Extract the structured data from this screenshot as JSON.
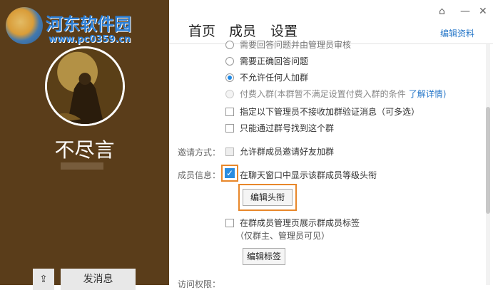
{
  "watermark": {
    "title": "河东软件园",
    "url": "www.pc0359.cn"
  },
  "profile": {
    "name": "不尽言",
    "send_message_label": "发消息"
  },
  "tabs": [
    "首页",
    "成员",
    "设置"
  ],
  "edit_profile": "编辑资料",
  "join_options": {
    "truncated_top": "需要回答问题并由管理员审核",
    "need_answer": "需要正确回答问题",
    "no_one_join": "不允许任何人加群",
    "paid_join": "付费入群(本群暂不满足设置付费入群的条件",
    "learn_more": "了解详情)",
    "admin_no_verify": "指定以下管理员不接收加群验证消息（可多选）",
    "search_only": "只能通过群号找到这个群"
  },
  "invite": {
    "label": "邀请方式：",
    "option": "允许群成员邀请好友加群"
  },
  "member_info": {
    "label": "成员信息：",
    "show_title": "在聊天窗口中显示该群成员等级头衔",
    "edit_title_button": "编辑头衔",
    "show_tags": "在群成员管理页展示群成员标签",
    "tags_note": "（仅群主、管理员可见）",
    "edit_tags_button": "编辑标签"
  },
  "bottom_label": "访问权限："
}
